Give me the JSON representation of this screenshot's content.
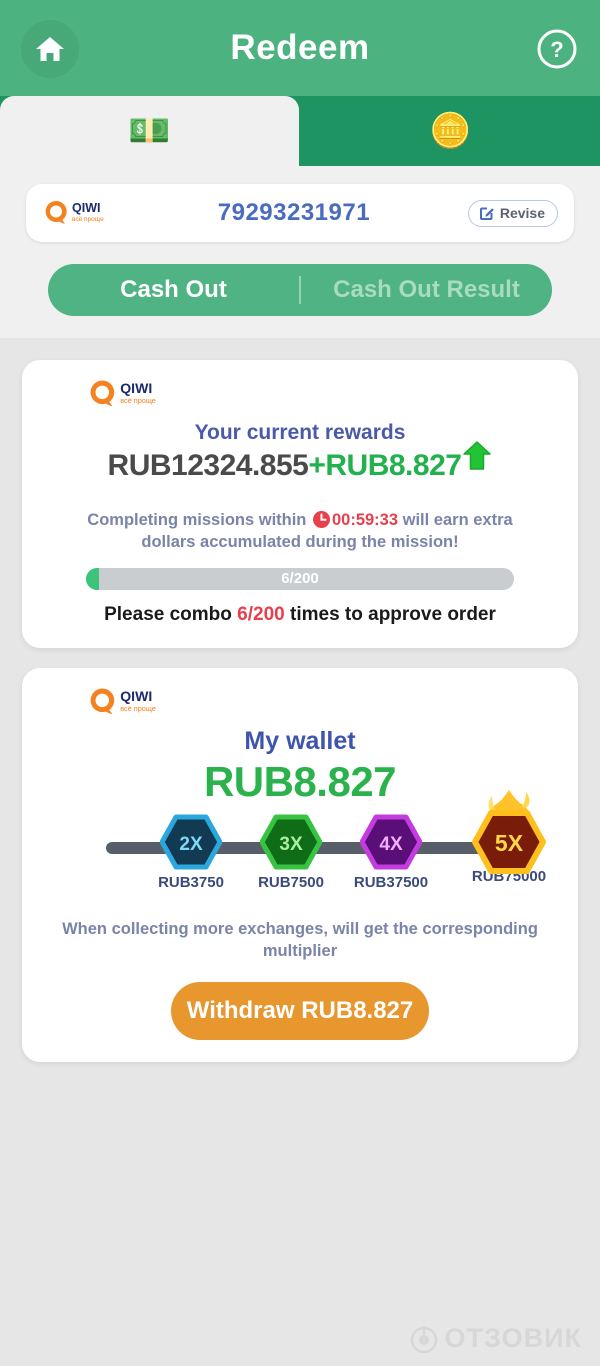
{
  "header": {
    "title": "Redeem",
    "home_icon": "home-icon",
    "help_icon": "question-circle-icon"
  },
  "tabs": [
    {
      "id": "cash",
      "icon": "money-bills-emoji",
      "glyph": "💵",
      "active": true
    },
    {
      "id": "coin",
      "icon": "coin-emoji",
      "glyph": "🪙",
      "active": false
    }
  ],
  "account": {
    "brand": "QIWI",
    "brand_tagline": "всё проще",
    "phone_number": "79293231971",
    "revise_label": "Revise",
    "revise_icon": "edit-square-icon"
  },
  "segmented": {
    "cash_out_label": "Cash Out",
    "cash_out_result_label": "Cash Out Result",
    "active": "Cash Out"
  },
  "rewards_card": {
    "brand": "QIWI",
    "brand_tagline": "всё проще",
    "heading": "Your current rewards",
    "base_amount": "RUB12324.855",
    "bonus_amount": "+RUB8.827",
    "trend_icon": "up-arrow-emoji",
    "mission_prefix": "Completing missions within ",
    "mission_timer": "00:59:33",
    "mission_suffix": " will earn extra dollars accumulated during the mission!",
    "timer_icon": "clock-icon",
    "progress_text": "6/200",
    "progress_current": 6,
    "progress_total": 200,
    "progress_percent": 3,
    "combo_prefix": "Please combo ",
    "combo_value": "6/200",
    "combo_suffix": " times to approve order"
  },
  "wallet_card": {
    "brand": "QIWI",
    "brand_tagline": "всё проще",
    "title": "My wallet",
    "amount": "RUB8.827",
    "tiers": [
      {
        "multiplier": "2X",
        "amount": "RUB3750",
        "color": "#2aa8dd",
        "inner": "#123a52",
        "text": "#7fd8f5"
      },
      {
        "multiplier": "3X",
        "amount": "RUB7500",
        "color": "#38c442",
        "inner": "#0f6d18",
        "text": "#a9f0a0"
      },
      {
        "multiplier": "4X",
        "amount": "RUB37500",
        "color": "#c43ce0",
        "inner": "#5a0f78",
        "text": "#f0b0ff"
      },
      {
        "multiplier": "5X",
        "amount": "RUB75000",
        "color": "#ffc01e",
        "inner": "#7a1c0a",
        "text": "#ffd84a",
        "flame": true
      }
    ],
    "note": "When collecting more exchanges,  will get the corresponding multiplier",
    "withdraw_label": "Withdraw RUB8.827"
  },
  "watermark": {
    "text": "ОТЗОВИК",
    "icon": "target-circle-icon"
  },
  "colors": {
    "header_green": "#4cb380",
    "tab_bar_green": "#1f9463",
    "page_bg": "#e6e6e6",
    "panel_bg": "#f0f0f0",
    "accent_green": "#2bb24c",
    "accent_orange": "#e8962e",
    "accent_red": "#e8404a",
    "accent_blue": "#4a5aa8"
  }
}
